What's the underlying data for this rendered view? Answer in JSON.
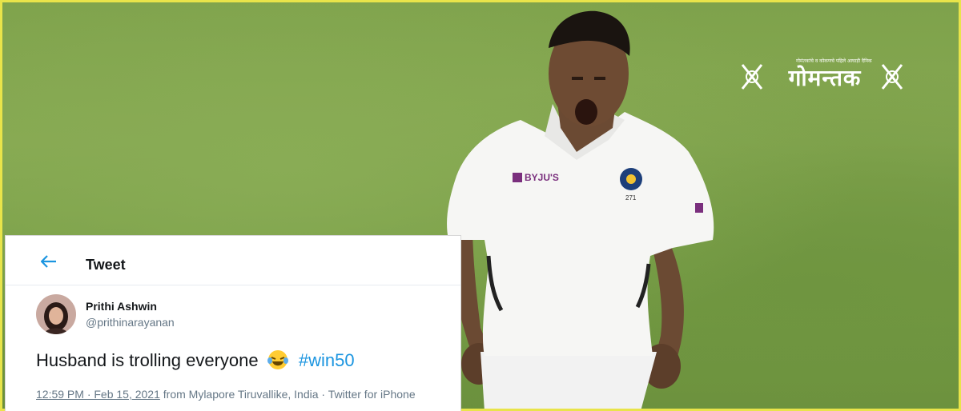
{
  "photo": {
    "jersey_sponsor": "BYJU'S",
    "jersey_number": "271"
  },
  "logo": {
    "name": "गोमन्तक",
    "tagline": "गोमंतकांचे व कोकणचे पहिले आघाड़ी दैनिक"
  },
  "tweet": {
    "header_title": "Tweet",
    "author_name": "Prithi Ashwin",
    "author_handle": "@prithinarayanan",
    "text": "Husband is trolling everyone",
    "hashtag": "#win50",
    "time": "12:59 PM · Feb 15, 2021",
    "location_app": " from Mylapore Tiruvallike, India · Twitter for iPhone"
  },
  "colors": {
    "accent": "#1b95e0",
    "border_highlight": "#e9e44a",
    "grass": "#7ea24b"
  }
}
